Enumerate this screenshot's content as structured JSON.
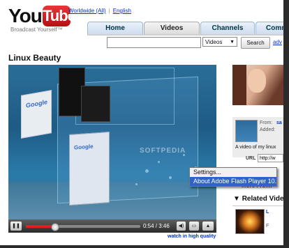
{
  "header": {
    "logo_you": "You",
    "logo_tube": "Tube",
    "slogan": "Broadcast Yourself™",
    "top_links": [
      "Worldwide (All)",
      "English"
    ]
  },
  "tabs": [
    {
      "label": "Home"
    },
    {
      "label": "Videos"
    },
    {
      "label": "Channels"
    },
    {
      "label": "Comm"
    }
  ],
  "search": {
    "query": "",
    "type_selected": "Videos",
    "button_label": "Search",
    "advanced_link": "adv"
  },
  "video": {
    "title": "Linux Beauty",
    "watermark": "SOFTPEDIA",
    "current_time": "0:54",
    "total_time": "3:46",
    "progress": 0.25,
    "hq_link": "watch in high quality"
  },
  "context_menu": {
    "items": [
      "Settings...",
      "About Adobe Flash Player 10..."
    ],
    "highlighted_index": 1
  },
  "sidebar": {
    "from_label": "From:",
    "from_user": "sa",
    "added_label": "Added:",
    "description": "A video of my linux",
    "url_label": "URL",
    "url_value": "http://w",
    "more_from": "More From:",
    "related_title": "Related Vide",
    "related_text": "L",
    "related_text2": "F"
  },
  "icons": {
    "play_pause": "pause-icon",
    "volume": "volume-icon",
    "resize": "resize-icon",
    "fullscreen": "fullscreen-icon"
  }
}
